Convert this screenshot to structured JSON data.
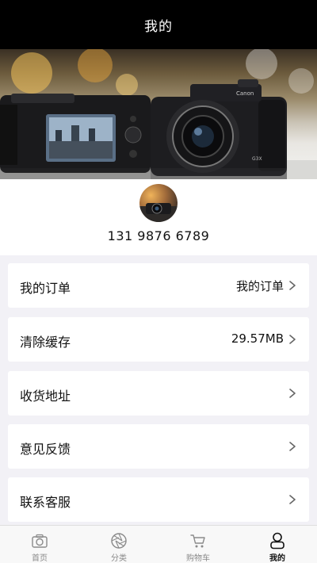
{
  "header": {
    "title": "我的"
  },
  "profile": {
    "phone": "131 9876 6789"
  },
  "menu": [
    {
      "label": "我的订单",
      "value": "我的订单"
    },
    {
      "label": "清除缓存",
      "value": "29.57MB"
    },
    {
      "label": "收货地址",
      "value": ""
    },
    {
      "label": "意见反馈",
      "value": ""
    },
    {
      "label": "联系客服",
      "value": ""
    }
  ],
  "tabbar": {
    "items": [
      {
        "label": "首页",
        "icon": "camera-icon",
        "active": false
      },
      {
        "label": "分类",
        "icon": "aperture-icon",
        "active": false
      },
      {
        "label": "购物车",
        "icon": "cart-icon",
        "active": false
      },
      {
        "label": "我的",
        "icon": "user-icon",
        "active": true
      }
    ]
  },
  "colors": {
    "header_bg": "#000000",
    "page_bg": "#f2f1f6",
    "card_bg": "#ffffff",
    "tab_inactive": "#8a8a8a",
    "tab_active": "#111111"
  }
}
